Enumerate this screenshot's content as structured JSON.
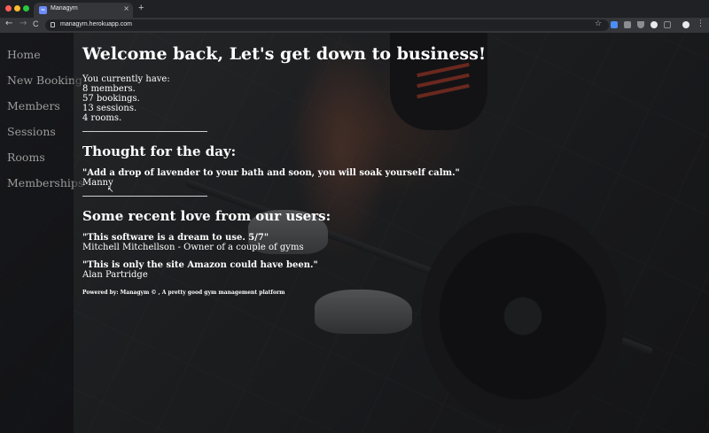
{
  "browser": {
    "tab_title": "Managym",
    "tab_close": "×",
    "new_tab": "+",
    "back": "←",
    "forward": "→",
    "reload": "C",
    "url": "managym.herokuapp.com",
    "bookmark_star": "☆",
    "menu": "⋮"
  },
  "sidebar": {
    "items": [
      {
        "label": "Home"
      },
      {
        "label": "New Booking"
      },
      {
        "label": "Members"
      },
      {
        "label": "Sessions"
      },
      {
        "label": "Rooms"
      },
      {
        "label": "Memberships"
      }
    ]
  },
  "main": {
    "title": "Welcome back, Let's get down to business!",
    "stats_intro": "You currently have:",
    "stats": [
      "8 members.",
      "57 bookings.",
      "13 sessions.",
      "4 rooms."
    ],
    "thought_heading": "Thought for the day:",
    "thought_quote": "\"Add a drop of lavender to your bath and soon, you will soak yourself calm.\"",
    "thought_author": "Manny",
    "love_heading": "Some recent love from our users:",
    "testimonials": [
      {
        "quote": "\"This software is a dream to use. 5/7\"",
        "author": "Mitchell Mitchellson - Owner of a couple of gyms"
      },
      {
        "quote": "\"This is only the site Amazon could have been.\"",
        "author": "Alan Partridge"
      }
    ],
    "footer": "Powered by: Managym © , A pretty good gym management platform"
  }
}
